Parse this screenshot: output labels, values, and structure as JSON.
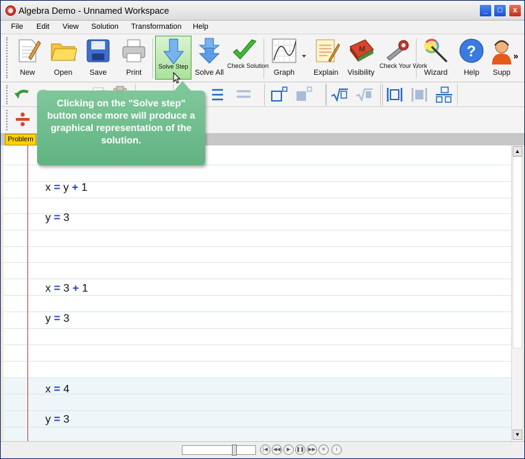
{
  "window": {
    "title": "Algebra Demo - Unnamed Workspace",
    "controls": [
      "_",
      "□",
      "x"
    ]
  },
  "menu": [
    "File",
    "Edit",
    "View",
    "Solution",
    "Transformation",
    "Help"
  ],
  "toolbar": {
    "new": "New",
    "open": "Open",
    "save": "Save",
    "print": "Print",
    "solve_step": "Solve Step",
    "solve_all": "Solve All",
    "check_solution": "Check Solution",
    "graph": "Graph",
    "explain": "Explain",
    "visibility": "Visibility",
    "check_work": "Check Your Work",
    "wizard": "Wizard",
    "help": "Help",
    "support": "Supp",
    "more": "»"
  },
  "tab": {
    "problem": "Problem"
  },
  "tooltip": "Clicking on the \"Solve step\" button once more will produce a graphical representation of the solution.",
  "worksheet": {
    "steps": [
      {
        "eq1": [
          "x",
          "=",
          "y",
          "+",
          "1"
        ],
        "eq2": [
          "y",
          "=",
          "3"
        ]
      },
      {
        "eq1": [
          "x",
          "=",
          "3",
          "+",
          "1"
        ],
        "eq2": [
          "y",
          "=",
          "3"
        ]
      },
      {
        "eq1": [
          "x",
          "=",
          "4"
        ],
        "eq2": [
          "y",
          "=",
          "3"
        ]
      }
    ]
  },
  "colors": {
    "operator": "#1f3fc0",
    "margin_line": "#c93a3a",
    "callout": "#6dbb8c",
    "active_tool": "#a9e29b"
  }
}
